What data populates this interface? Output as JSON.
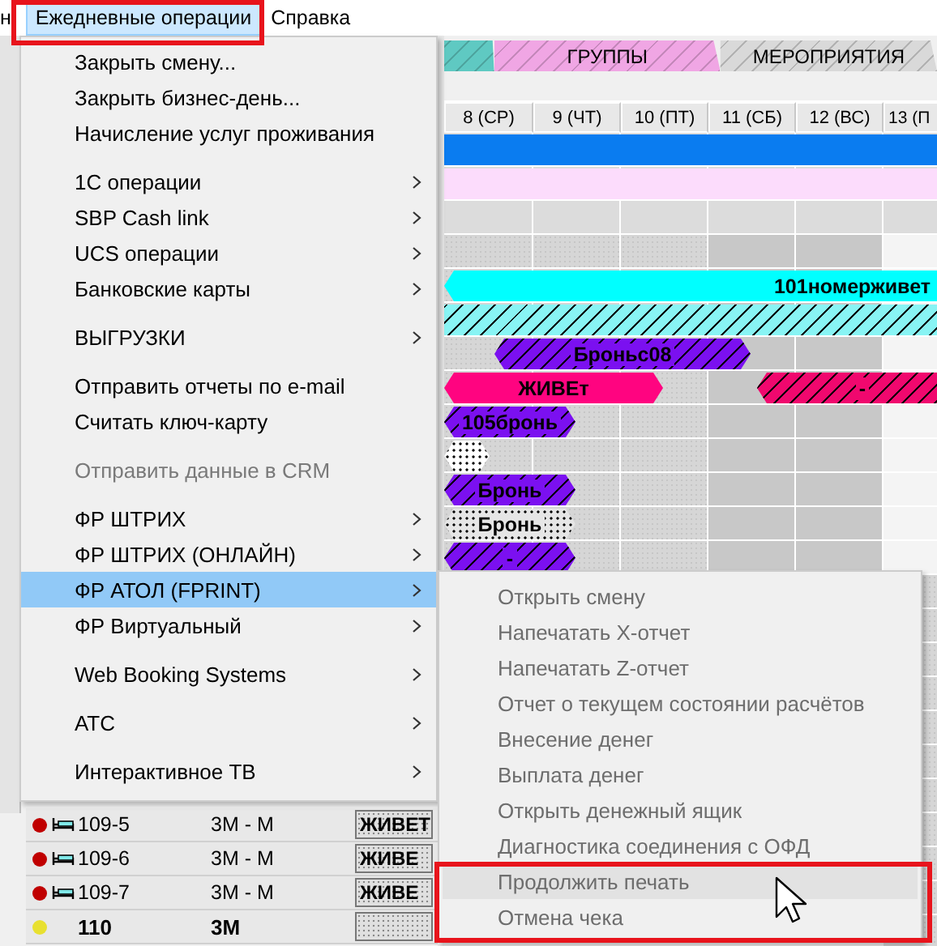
{
  "menu_bar": [
    {
      "label": "н",
      "selected": false
    },
    {
      "label": "Ежедневные операции",
      "selected": true
    },
    {
      "label": "Справка",
      "selected": false
    }
  ],
  "tabs": [
    {
      "color": "#5fc9c2"
    },
    {
      "label": "ГРУППЫ",
      "color": "#f0a6e4"
    },
    {
      "label": "МЕРОПРИЯТИЯ",
      "color": "#d9d9d9"
    }
  ],
  "days": [
    "8 (СР)",
    "9 (ЧТ)",
    "10 (ПТ)",
    "11 (СБ)",
    "12 (ВС)",
    "13 (П"
  ],
  "schedule_rows": [
    {
      "bars": [
        {
          "kind": "solid",
          "color": "#0a7cf0"
        }
      ]
    },
    {
      "bars": [
        {
          "kind": "solid",
          "color": "#fcdcfc"
        }
      ]
    },
    {
      "bars": []
    },
    {
      "bars": []
    },
    {
      "bars": [
        {
          "kind": "solid",
          "color": "#00ffff",
          "label": "101номерживет"
        }
      ]
    },
    {
      "bars": [
        {
          "kind": "hatched",
          "color": "#88f4f4"
        }
      ]
    },
    {
      "bars": [
        {
          "kind": "hatched",
          "color": "#7b10f0",
          "label": "Броньс08"
        }
      ]
    },
    {
      "bars": [
        {
          "kind": "solid",
          "color": "#ff0480",
          "label": "ЖИВЕт"
        },
        {
          "kind": "hatched",
          "color": "#f0086e",
          "label": "-"
        }
      ]
    },
    {
      "bars": [
        {
          "kind": "hatched",
          "color": "#7b10f0",
          "label": "105бронь"
        }
      ]
    },
    {
      "bars": [
        {
          "kind": "dotted",
          "color": "#ffffff"
        }
      ]
    },
    {
      "bars": [
        {
          "kind": "hatched",
          "color": "#7b10f0",
          "label": "Бронь"
        }
      ]
    },
    {
      "bars": [
        {
          "kind": "dotted",
          "color": "#e6e6e6",
          "label": "Бронь"
        }
      ]
    },
    {
      "bars": [
        {
          "kind": "hatched",
          "color": "#7b10f0",
          "label": "-"
        }
      ]
    },
    {
      "bars": []
    },
    {
      "bars": []
    },
    {
      "bars": []
    },
    {
      "bars": []
    },
    {
      "bars": []
    },
    {
      "bars": []
    },
    {
      "bars": []
    },
    {
      "bars": []
    },
    {
      "bars": []
    },
    {
      "bars": []
    },
    {
      "bars": []
    }
  ],
  "rooms": [
    {
      "kind": "bed",
      "color": "#c00000",
      "room": "109-5",
      "type": "3M - M",
      "status": "ЖИВЕТ"
    },
    {
      "kind": "bed",
      "color": "#c00000",
      "room": "109-6",
      "type": "3M - M",
      "status": "ЖИВЕ"
    },
    {
      "kind": "bed",
      "color": "#c00000",
      "room": "109-7",
      "type": "3M - M",
      "status": "ЖИВЕ"
    },
    {
      "kind": "room",
      "color": "#e8e030",
      "room": "110",
      "type": "3M"
    }
  ],
  "dropdown": {
    "groups": [
      [
        {
          "label": "Закрыть смену...",
          "disabled": false,
          "submenu": false,
          "selected": false
        },
        {
          "label": "Закрыть бизнес-день...",
          "disabled": false,
          "submenu": false,
          "selected": false
        },
        {
          "label": "Начисление услуг проживания",
          "disabled": false,
          "submenu": false,
          "selected": false
        }
      ],
      [
        {
          "label": "1С операции",
          "disabled": false,
          "submenu": true,
          "selected": false
        },
        {
          "label": "SBP Cash link",
          "disabled": false,
          "submenu": true,
          "selected": false
        },
        {
          "label": "UCS операции",
          "disabled": false,
          "submenu": true,
          "selected": false
        },
        {
          "label": "Банковские карты",
          "disabled": false,
          "submenu": true,
          "selected": false
        }
      ],
      [
        {
          "label": "ВЫГРУЗКИ",
          "disabled": false,
          "submenu": true,
          "selected": false
        }
      ],
      [
        {
          "label": "Отправить отчеты по e-mail",
          "disabled": false,
          "submenu": false,
          "selected": false
        },
        {
          "label": "Считать ключ-карту",
          "disabled": false,
          "submenu": false,
          "selected": false
        }
      ],
      [
        {
          "label": "Отправить данные в CRM",
          "disabled": true,
          "submenu": false,
          "selected": false
        }
      ],
      [
        {
          "label": "ФР ШТРИХ",
          "disabled": false,
          "submenu": true,
          "selected": false
        },
        {
          "label": "ФР ШТРИХ (ОНЛАЙН)",
          "disabled": false,
          "submenu": true,
          "selected": false
        },
        {
          "label": "ФР АТОЛ (FPRINT)",
          "disabled": false,
          "submenu": true,
          "selected": true
        },
        {
          "label": "ФР Виртуальный",
          "disabled": false,
          "submenu": true,
          "selected": false
        }
      ],
      [
        {
          "label": "Web Booking Systems",
          "disabled": false,
          "submenu": true,
          "selected": false
        }
      ],
      [
        {
          "label": "АТС",
          "disabled": false,
          "submenu": true,
          "selected": false
        }
      ],
      [
        {
          "label": "Интерактивное ТВ",
          "disabled": false,
          "submenu": true,
          "selected": false
        }
      ]
    ]
  },
  "submenu": {
    "items": [
      {
        "label": "Открыть смену",
        "disabled": true,
        "selected": false
      },
      {
        "label": "Напечатать X-отчет",
        "disabled": true,
        "selected": false
      },
      {
        "label": "Напечатать Z-отчет",
        "disabled": true,
        "selected": false
      },
      {
        "label": "Отчет о текущем состоянии расчётов",
        "disabled": true,
        "selected": false
      },
      {
        "label": "Внесение денег",
        "disabled": true,
        "selected": false
      },
      {
        "label": "Выплата денег",
        "disabled": true,
        "selected": false
      },
      {
        "label": "Открыть денежный ящик",
        "disabled": true,
        "selected": false
      },
      {
        "label": "Диагностика соединения с ОФД",
        "disabled": true,
        "selected": false
      },
      {
        "label": "Продолжить печать",
        "disabled": true,
        "selected": true
      },
      {
        "label": "Отмена чека",
        "disabled": true,
        "selected": false
      }
    ]
  }
}
